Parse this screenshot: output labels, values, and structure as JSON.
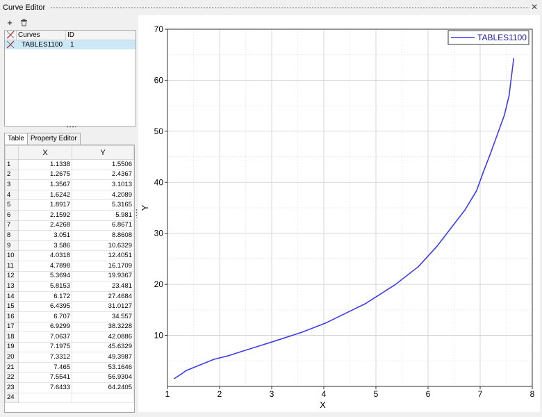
{
  "window": {
    "title": "Curve Editor"
  },
  "toolbar": {
    "add_icon": "+",
    "delete_icon": "trash-icon"
  },
  "curves": {
    "columns": [
      "Curves",
      "ID"
    ],
    "rows": [
      {
        "name": "TABLES1100",
        "id": "1"
      }
    ]
  },
  "tabs": [
    "Table",
    "Property Editor"
  ],
  "table": {
    "columns": [
      "X",
      "Y"
    ],
    "rows": [
      [
        "1",
        "1.1338",
        "1.5506"
      ],
      [
        "2",
        "1.2675",
        "2.4367"
      ],
      [
        "3",
        "1.3567",
        "3.1013"
      ],
      [
        "4",
        "1.6242",
        "4.2089"
      ],
      [
        "5",
        "1.8917",
        "5.3165"
      ],
      [
        "6",
        "2.1592",
        "5.981"
      ],
      [
        "7",
        "2.4268",
        "6.8671"
      ],
      [
        "8",
        "3.051",
        "8.8608"
      ],
      [
        "9",
        "3.586",
        "10.6329"
      ],
      [
        "10",
        "4.0318",
        "12.4051"
      ],
      [
        "11",
        "4.7898",
        "16.1709"
      ],
      [
        "12",
        "5.3694",
        "19.9367"
      ],
      [
        "13",
        "5.8153",
        "23.481"
      ],
      [
        "14",
        "6.172",
        "27.4684"
      ],
      [
        "15",
        "6.4395",
        "31.0127"
      ],
      [
        "16",
        "6.707",
        "34.557"
      ],
      [
        "17",
        "6.9299",
        "38.3228"
      ],
      [
        "18",
        "7.0637",
        "42.0886"
      ],
      [
        "19",
        "7.1975",
        "45.6329"
      ],
      [
        "20",
        "7.3312",
        "49.3987"
      ],
      [
        "21",
        "7.465",
        "53.1646"
      ],
      [
        "22",
        "7.5541",
        "56.9304"
      ],
      [
        "23",
        "7.6433",
        "64.2405"
      ],
      [
        "24",
        "",
        ""
      ]
    ]
  },
  "chart_data": {
    "type": "line",
    "title": "",
    "xlabel": "X",
    "ylabel": "Y",
    "xlim": [
      1,
      8
    ],
    "ylim": [
      0,
      70
    ],
    "xticks": [
      1,
      2,
      3,
      4,
      5,
      6,
      7,
      8
    ],
    "yticks": [
      10,
      20,
      30,
      40,
      50,
      60,
      70
    ],
    "grid": true,
    "legend_position": "top-right",
    "series": [
      {
        "name": "TABLES1100",
        "color": "#3c3cf0",
        "x": [
          1.1338,
          1.2675,
          1.3567,
          1.6242,
          1.8917,
          2.1592,
          2.4268,
          3.051,
          3.586,
          4.0318,
          4.7898,
          5.3694,
          5.8153,
          6.172,
          6.4395,
          6.707,
          6.9299,
          7.0637,
          7.1975,
          7.3312,
          7.465,
          7.5541,
          7.6433
        ],
        "y": [
          1.5506,
          2.4367,
          3.1013,
          4.2089,
          5.3165,
          5.981,
          6.8671,
          8.8608,
          10.6329,
          12.4051,
          16.1709,
          19.9367,
          23.481,
          27.4684,
          31.0127,
          34.557,
          38.3228,
          42.0886,
          45.6329,
          49.3987,
          53.1646,
          56.9304,
          64.2405
        ]
      }
    ]
  }
}
